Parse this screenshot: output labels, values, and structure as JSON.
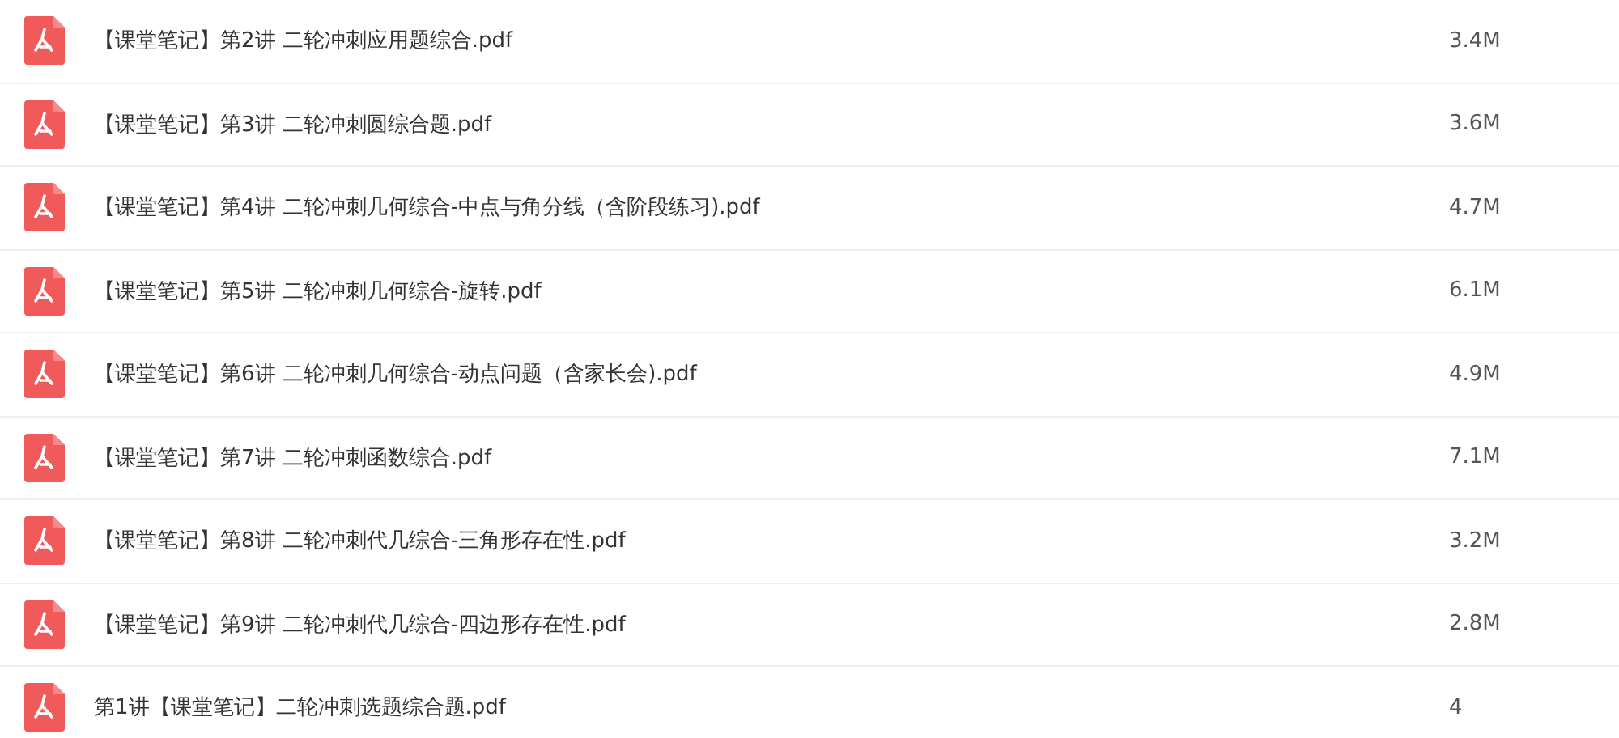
{
  "files": [
    {
      "name": "【课堂笔记】第2讲 二轮冲刺应用题综合.pdf",
      "size": "3.4M"
    },
    {
      "name": "【课堂笔记】第3讲 二轮冲刺圆综合题.pdf",
      "size": "3.6M"
    },
    {
      "name": "【课堂笔记】第4讲 二轮冲刺几何综合-中点与角分线（含阶段练习).pdf",
      "size": "4.7M"
    },
    {
      "name": "【课堂笔记】第5讲 二轮冲刺几何综合-旋转.pdf",
      "size": "6.1M"
    },
    {
      "name": "【课堂笔记】第6讲 二轮冲刺几何综合-动点问题（含家长会).pdf",
      "size": "4.9M"
    },
    {
      "name": "【课堂笔记】第7讲 二轮冲刺函数综合.pdf",
      "size": "7.1M"
    },
    {
      "name": "【课堂笔记】第8讲 二轮冲刺代几综合-三角形存在性.pdf",
      "size": "3.2M"
    },
    {
      "name": "【课堂笔记】第9讲 二轮冲刺代几综合-四边形存在性.pdf",
      "size": "2.8M"
    },
    {
      "name": "第1讲【课堂笔记】二轮冲刺选题综合题.pdf",
      "size": "4"
    }
  ]
}
